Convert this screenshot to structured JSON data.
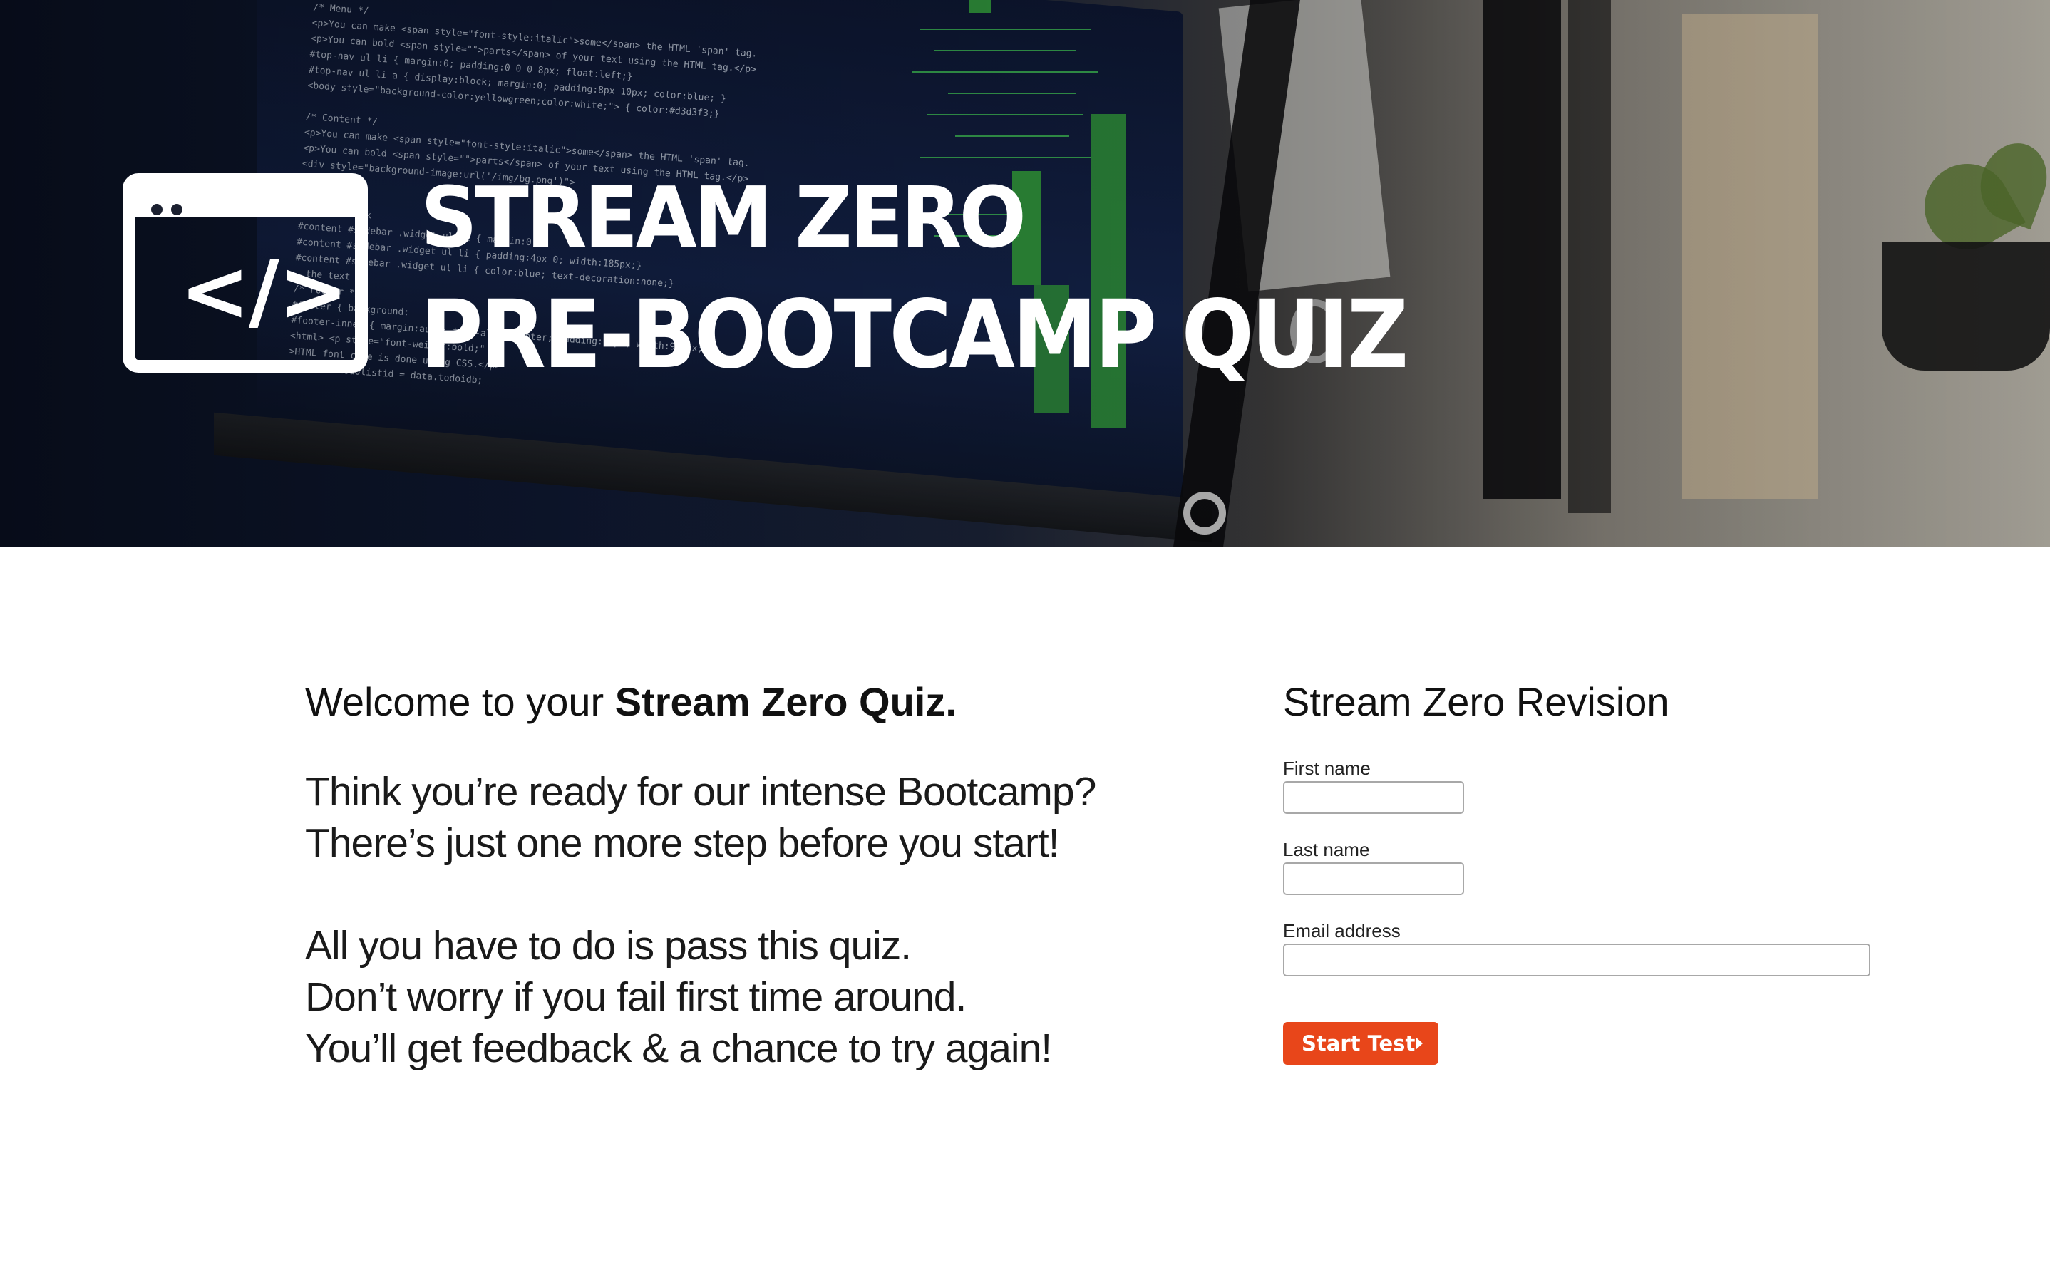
{
  "hero": {
    "title_line1": "STREAM ZERO",
    "title_line2": "PRE-BOOTCAMP QUIZ",
    "logo_glyph": "</>"
  },
  "welcome": {
    "prefix": "Welcome to your ",
    "bold": "Stream Zero Quiz."
  },
  "intro": {
    "lines": [
      "Think you’re ready for our intense Bootcamp?",
      "There’s just one more step before you start!",
      "All you have to do is pass this quiz.",
      "Don’t worry if you fail first time around.",
      "You’ll get feedback & a chance to try again!"
    ]
  },
  "form": {
    "title": "Stream Zero Revision",
    "first_name_label": "First name",
    "first_name_value": "",
    "last_name_label": "Last name",
    "last_name_value": "",
    "email_label": "Email address",
    "email_value": "",
    "submit_label": "Start Test"
  },
  "colors": {
    "accent": "#e8461a",
    "hero_dark": "#0b1226",
    "code_green": "#2f8f3a"
  }
}
